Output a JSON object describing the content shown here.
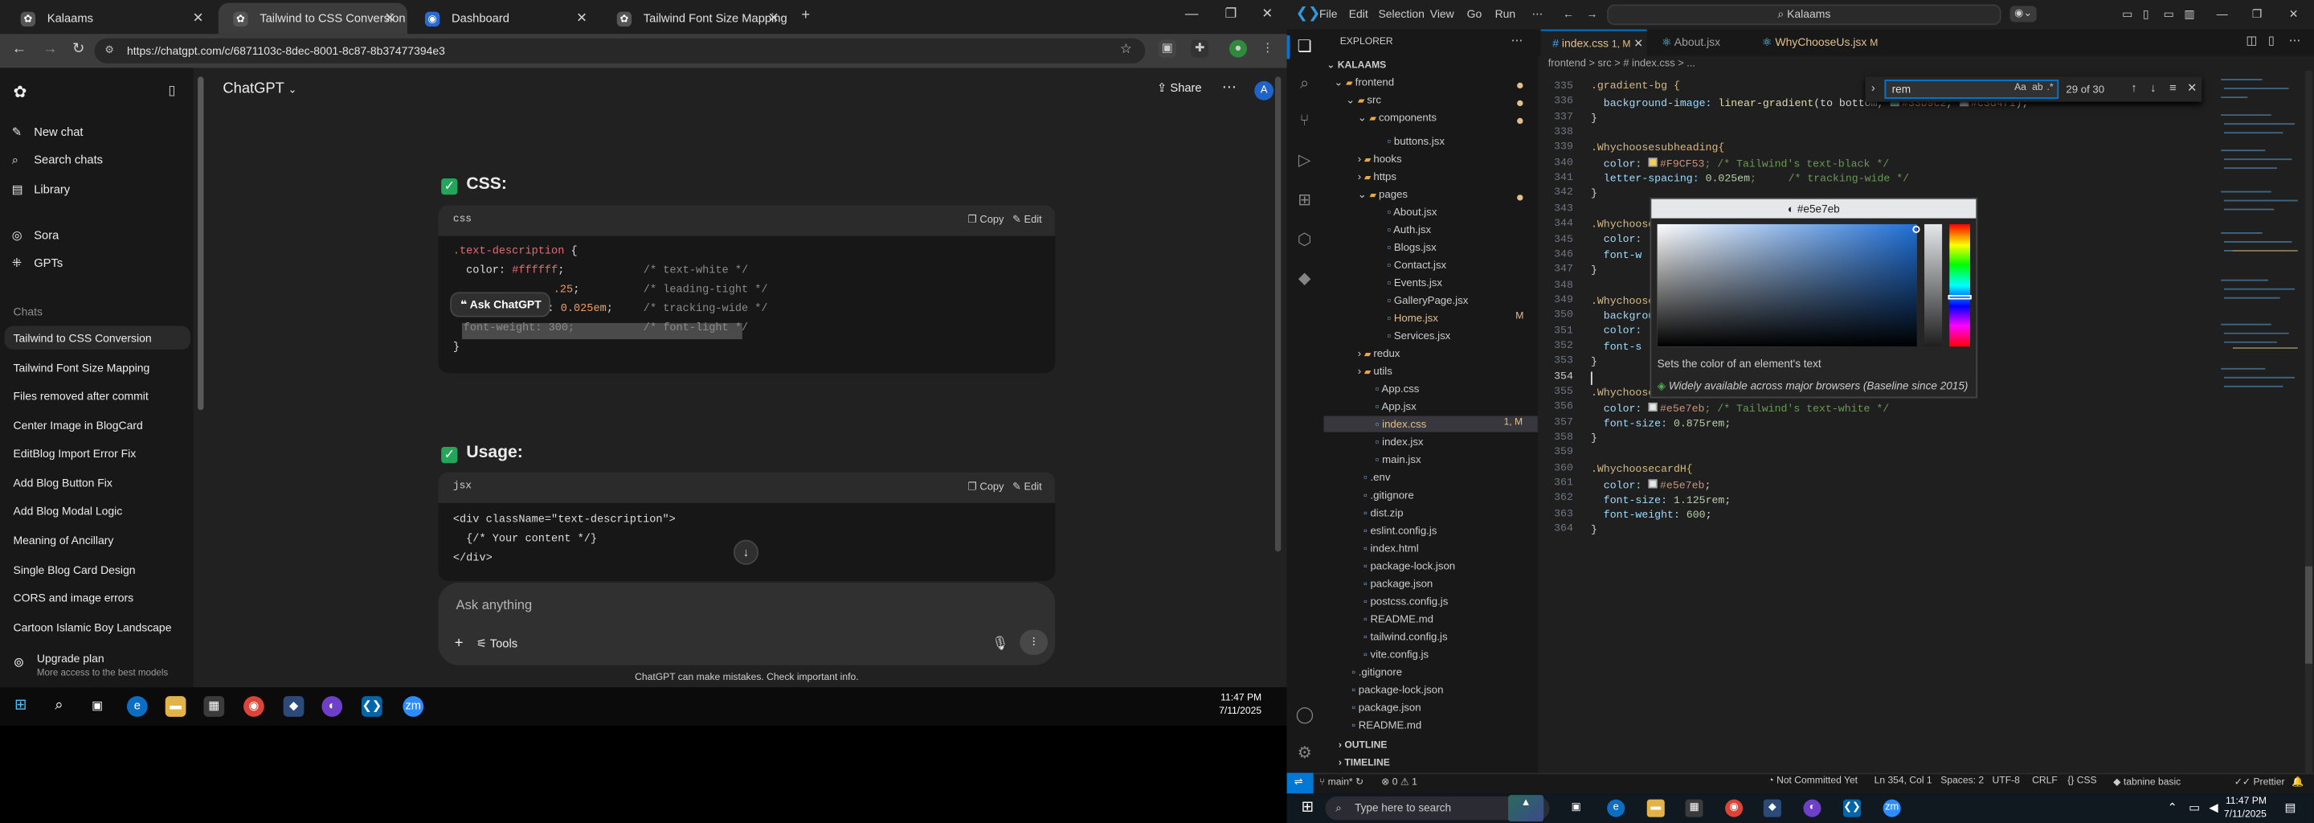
{
  "browser": {
    "tabs": [
      {
        "title": "Kalaams",
        "icon": "chatgpt-icon"
      },
      {
        "title": "Tailwind to CSS Conversion",
        "icon": "chatgpt-icon"
      },
      {
        "title": "Dashboard",
        "icon": "globe-icon"
      },
      {
        "title": "Tailwind Font Size Mapping",
        "icon": "chatgpt-icon"
      }
    ],
    "url": "https://chatgpt.com/c/6871103c-8dec-8001-8c87-8b37477394e3"
  },
  "chatgpt": {
    "sidebar": {
      "new_chat": "New chat",
      "search_chats": "Search chats",
      "library": "Library",
      "sora": "Sora",
      "gpts": "GPTs",
      "chats_label": "Chats",
      "chats": [
        "Tailwind to CSS Conversion",
        "Tailwind Font Size Mapping",
        "Files removed after commit",
        "Center Image in BlogCard",
        "EditBlog Import Error Fix",
        "Add Blog Button Fix",
        "Add Blog Modal Logic",
        "Meaning of Ancillary",
        "Single Blog Card Design",
        "CORS and image errors",
        "Cartoon Islamic Boy Landscape"
      ],
      "upgrade_title": "Upgrade plan",
      "upgrade_sub": "More access to the best models"
    },
    "model": "ChatGPT",
    "share": "Share",
    "avatar": "A",
    "section_css": "CSS:",
    "section_usage": "Usage:",
    "copy": "Copy",
    "edit": "Edit",
    "css_lang": "css",
    "jsx_lang": "jsx",
    "css_code": {
      "selector": ".text-description",
      "open": " {",
      "l1_prop": "  color: ",
      "l1_val": "#ffffff",
      "l1_end": ";",
      "l1_cmt": "/* text-white */",
      "l2_val": ".25",
      "l2_end": ";",
      "l2_cmt": "/* leading-tight */",
      "l3_prefix": ": ",
      "l3_val": "0.025em",
      "l3_end": ";",
      "l3_cmt": "/* tracking-wide */",
      "l4_code": "font-weight: 300;",
      "l4_cmt": "/* font-light */",
      "close": "}"
    },
    "ask_chatgpt": "Ask ChatGPT",
    "jsx_code": {
      "l1": "<div className=\"text-description\">",
      "l2": "  {/* Your content */}",
      "l3": "</div>"
    },
    "composer_placeholder": "Ask anything",
    "tools": "Tools",
    "disclaimer": "ChatGPT can make mistakes. Check important info."
  },
  "left_clock": {
    "time": "11:47 PM",
    "date": "7/11/2025"
  },
  "vscode": {
    "menu": [
      "File",
      "Edit",
      "Selection",
      "View",
      "Go",
      "Run"
    ],
    "search": "Kalaams",
    "explorer_title": "EXPLORER",
    "project": "KALAAMS",
    "tree": [
      {
        "name": "frontend",
        "type": "folder",
        "open": true
      },
      {
        "name": "src",
        "type": "folder",
        "open": true
      },
      {
        "name": "components",
        "type": "folder",
        "open": true
      },
      {
        "name": "buttons.jsx",
        "type": "file"
      },
      {
        "name": "hooks",
        "type": "folder"
      },
      {
        "name": "https",
        "type": "folder"
      },
      {
        "name": "pages",
        "type": "folder",
        "open": true
      },
      {
        "name": "About.jsx",
        "type": "file"
      },
      {
        "name": "Auth.jsx",
        "type": "file"
      },
      {
        "name": "Blogs.jsx",
        "type": "file"
      },
      {
        "name": "Contact.jsx",
        "type": "file"
      },
      {
        "name": "Events.jsx",
        "type": "file"
      },
      {
        "name": "GalleryPage.jsx",
        "type": "file"
      },
      {
        "name": "Home.jsx",
        "type": "file",
        "badge": "M"
      },
      {
        "name": "Services.jsx",
        "type": "file"
      },
      {
        "name": "redux",
        "type": "folder"
      },
      {
        "name": "utils",
        "type": "folder"
      },
      {
        "name": "App.css",
        "type": "file"
      },
      {
        "name": "App.jsx",
        "type": "file"
      },
      {
        "name": "index.css",
        "type": "file",
        "badge": "1, M"
      },
      {
        "name": "index.jsx",
        "type": "file"
      },
      {
        "name": "main.jsx",
        "type": "file"
      },
      {
        "name": ".env",
        "type": "file"
      },
      {
        "name": ".gitignore",
        "type": "file"
      },
      {
        "name": "dist.zip",
        "type": "file"
      },
      {
        "name": "eslint.config.js",
        "type": "file"
      },
      {
        "name": "index.html",
        "type": "file"
      },
      {
        "name": "package-lock.json",
        "type": "file"
      },
      {
        "name": "package.json",
        "type": "file"
      },
      {
        "name": "postcss.config.js",
        "type": "file"
      },
      {
        "name": "README.md",
        "type": "file"
      },
      {
        "name": "tailwind.config.js",
        "type": "file"
      },
      {
        "name": "vite.config.js",
        "type": "file"
      },
      {
        "name": ".gitignore",
        "type": "file"
      },
      {
        "name": "package-lock.json",
        "type": "file"
      },
      {
        "name": "package.json",
        "type": "file"
      },
      {
        "name": "README.md",
        "type": "file"
      }
    ],
    "outline": "OUTLINE",
    "timeline": "TIMELINE",
    "editor_tabs": [
      {
        "title": "index.css",
        "badge": "1, M"
      },
      {
        "title": "About.jsx"
      },
      {
        "title": "WhyChooseUs.jsx",
        "badge": "M"
      }
    ],
    "breadcrumb": "frontend  >  src  >  # index.css  >  ...",
    "find": {
      "query": "rem",
      "count": "29 of 30"
    },
    "line_numbers": [
      "335",
      "336",
      "337",
      "338",
      "339",
      "340",
      "341",
      "342",
      "343",
      "344",
      "345",
      "346",
      "347",
      "348",
      "349",
      "350",
      "351",
      "352",
      "353",
      "354",
      "355",
      "356",
      "357",
      "358",
      "359",
      "360",
      "361",
      "362",
      "363",
      "364"
    ],
    "code": {
      "l335": ".gradient-bg {",
      "l336_prop": "  background-image: ",
      "l336_fn": "linear-gradient",
      "l336_rest": "(to bottom, ",
      "l336_c1": "#33b9c2",
      "l336_mid": ", ",
      "l336_c2": "#c3d4f1",
      "l336_end": ");",
      "l337": "}",
      "l339": ".Whychoosesubheading{",
      "l340_prop": "  color: ",
      "l340_val": "#F9CF53",
      "l340_cmt": "; /* Tailwind's text-black */",
      "l341_prop": "  letter-spacing: ",
      "l341_val": "0.025em",
      "l341_cmt": ";     /* tracking-wide */",
      "l342": "}",
      "l344": ".Whychoose",
      "l345": "  color: ",
      "l346": "  font-w",
      "l347": "}",
      "l349": ".Whychoose",
      "l350": "  backgrou",
      "l351": "  color: ",
      "l352": "  font-s",
      "l353": "}",
      "l355": ".Whychoose",
      "l356_prop": "  color: ",
      "l356_val": "#e5e7eb",
      "l356_cmt": "; /* Tailwind's text-white */",
      "l357_prop": "  font-size: ",
      "l357_val": "0.875rem",
      "l357_end": ";",
      "l358": "}",
      "l360": ".WhychoosecardH{",
      "l361_prop": "  color: ",
      "l361_val": "#e5e7eb",
      "l361_end": ";",
      "l362_prop": "  font-size: ",
      "l362_val": "1.125rem",
      "l362_end": ";",
      "l363_prop": "  font-weight: ",
      "l363_val": "600",
      "l363_end": ";",
      "l364": "}"
    },
    "color_picker": {
      "value": "#e5e7eb",
      "hover_desc": "Sets the color of an element's text",
      "baseline": "Widely available across major browsers (Baseline since 2015)"
    },
    "status": {
      "branch": "main*",
      "errors": "0",
      "warnings": "1",
      "commit": "Not Committed Yet",
      "position": "Ln 354, Col 1",
      "spaces": "Spaces: 2",
      "encoding": "UTF-8",
      "eol": "CRLF",
      "language": "CSS",
      "tabnine": "tabnine basic",
      "prettier": "Prettier"
    }
  },
  "windows": {
    "search_placeholder": "Type here to search",
    "time": "11:47 PM",
    "date": "7/11/2025"
  },
  "colors": {
    "accent_blue": "#0078d4",
    "chatgpt_bg": "#212121",
    "vscode_bg": "#1f1f1f",
    "check_green": "#23a55a"
  }
}
